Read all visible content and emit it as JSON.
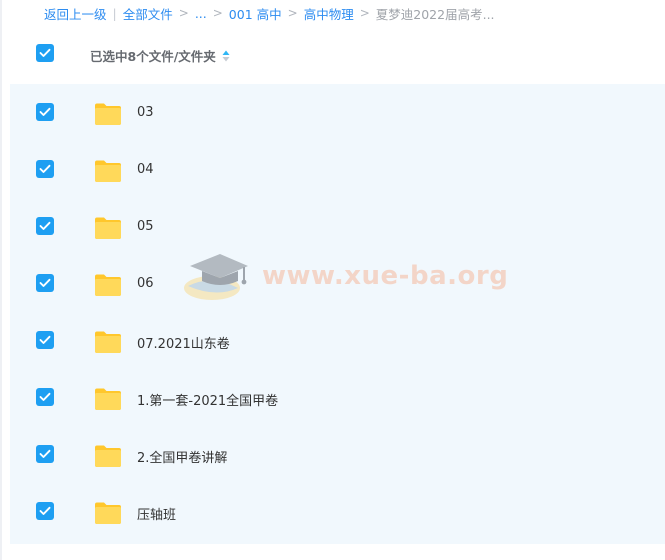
{
  "breadcrumb": {
    "back": "返回上一级",
    "all_files": "全部文件",
    "ellipsis": "...",
    "level1": "001 高中",
    "level2": "高中物理",
    "current": "夏梦迪2022届高考...",
    "separator": ">",
    "divider": "|"
  },
  "header": {
    "selection_text": "已选中8个文件/文件夹"
  },
  "files": [
    {
      "name": "03"
    },
    {
      "name": "04"
    },
    {
      "name": "05"
    },
    {
      "name": "06"
    },
    {
      "name": "07.2021山东卷"
    },
    {
      "name": "1.第一套-2021全国甲卷"
    },
    {
      "name": "2.全国甲卷讲解"
    },
    {
      "name": "压轴班"
    }
  ],
  "watermark": {
    "text": "www.xue-ba.org",
    "icon": "graduation-cap-icon"
  },
  "colors": {
    "accent": "#1e9ff2",
    "link": "#2d8cf0",
    "folder": "#ffcf3d",
    "list_bg": "#f1f8fd"
  }
}
